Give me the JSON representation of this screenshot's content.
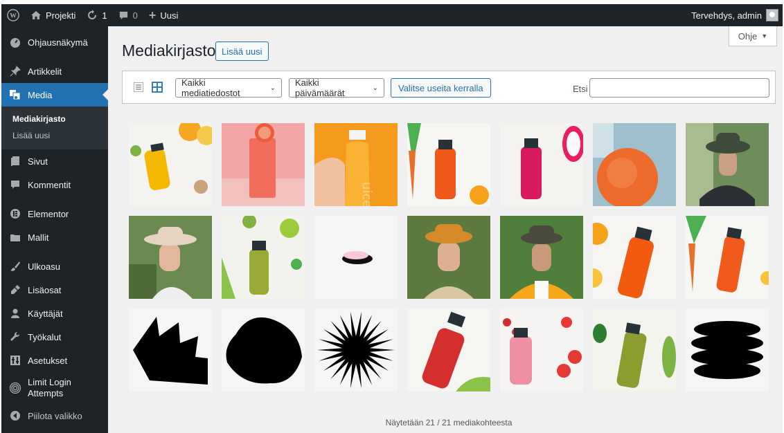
{
  "adminbar": {
    "site_name": "Projekti",
    "updates_count": "1",
    "comments_count": "0",
    "new_label": "Uusi",
    "greeting": "Tervehdys, admin"
  },
  "sidebar": {
    "items": [
      {
        "label": "Ohjausnäkymä",
        "icon": "dashboard-icon"
      },
      {
        "label": "Artikkelit",
        "icon": "pin-icon"
      },
      {
        "label": "Media",
        "icon": "media-icon",
        "active": true
      },
      {
        "label": "Sivut",
        "icon": "page-icon"
      },
      {
        "label": "Kommentit",
        "icon": "comment-icon"
      },
      {
        "label": "Elementor",
        "icon": "elementor-icon"
      },
      {
        "label": "Mallit",
        "icon": "folder-icon"
      },
      {
        "label": "Ulkoasu",
        "icon": "brush-icon"
      },
      {
        "label": "Lisäosat",
        "icon": "plugin-icon"
      },
      {
        "label": "Käyttäjät",
        "icon": "user-icon"
      },
      {
        "label": "Työkalut",
        "icon": "wrench-icon"
      },
      {
        "label": "Asetukset",
        "icon": "settings-icon"
      },
      {
        "label": "Limit Login Attempts",
        "icon": "fingerprint-icon"
      },
      {
        "label": "Piilota valikko",
        "icon": "collapse-icon"
      }
    ],
    "submenu": {
      "library": "Mediakirjasto",
      "add_new": "Lisää uusi"
    }
  },
  "help_tab": {
    "label": "Ohje"
  },
  "page": {
    "title": "Mediakirjasto",
    "add_new_label": "Lisää uusi"
  },
  "toolbar": {
    "filter_type": "Kaikki mediatiedostot",
    "filter_date": "Kaikki päivämäärät",
    "bulk_select": "Valitse useita kerralla",
    "search_label": "Etsi",
    "search_value": ""
  },
  "media_items": [
    {
      "name": "yellow-juice-citrus"
    },
    {
      "name": "pink-drink-grapefruit"
    },
    {
      "name": "orange-juice-bottle-hand"
    },
    {
      "name": "orange-juice-carrots"
    },
    {
      "name": "pink-juice-dragonfruit"
    },
    {
      "name": "grapefruit-blue-bowl"
    },
    {
      "name": "man-bucket-hat-portrait"
    },
    {
      "name": "woman-sunhat-portrait"
    },
    {
      "name": "green-juice-celery-lime"
    },
    {
      "name": "pink-ellipse-shape"
    },
    {
      "name": "woman-orange-hat-portrait"
    },
    {
      "name": "man-yellow-jacket-portrait"
    },
    {
      "name": "orange-juice-oranges"
    },
    {
      "name": "orange-juice-carrots-2"
    },
    {
      "name": "black-zigzag-shape"
    },
    {
      "name": "black-blob-shape"
    },
    {
      "name": "black-starburst-shape"
    },
    {
      "name": "red-juice-bottle"
    },
    {
      "name": "strawberry-juice-bottle"
    },
    {
      "name": "green-juice-cucumber"
    },
    {
      "name": "black-stack-shape"
    }
  ],
  "footer": {
    "count_text": "Näytetään 21 / 21 mediakohteesta"
  },
  "colors": {
    "accent": "#2271b1",
    "admin_dark": "#1d2327"
  }
}
